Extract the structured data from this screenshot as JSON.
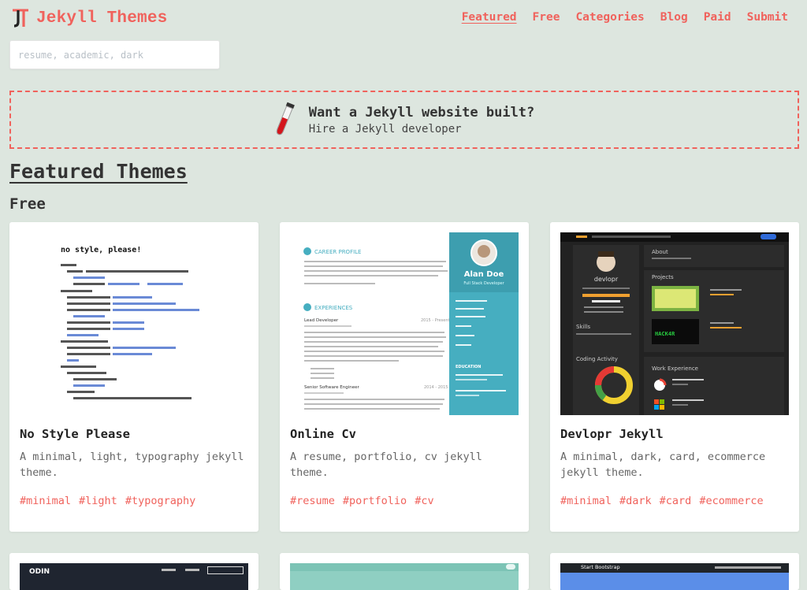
{
  "site": {
    "title": "Jekyll Themes",
    "logo_letters": "JT"
  },
  "nav": [
    {
      "label": "Featured",
      "active": true
    },
    {
      "label": "Free",
      "active": false
    },
    {
      "label": "Categories",
      "active": false
    },
    {
      "label": "Blog",
      "active": false
    },
    {
      "label": "Paid",
      "active": false
    },
    {
      "label": "Submit",
      "active": false
    }
  ],
  "search": {
    "placeholder": "resume, academic, dark"
  },
  "hire": {
    "title": "Want a Jekyll website built?",
    "subtitle": "Hire a Jekyll developer"
  },
  "section_title": "Featured Themes",
  "subsection_title": "Free",
  "cards": [
    {
      "name": "No Style Please",
      "description": "A minimal, light, typography jekyll theme.",
      "tags": [
        "#minimal",
        "#light",
        "#typography"
      ],
      "thumb_title": "no style, please!"
    },
    {
      "name": "Online Cv",
      "description": "A resume, portfolio, cv jekyll theme.",
      "tags": [
        "#resume",
        "#portfolio",
        "#cv"
      ],
      "thumb_name": "Alan Doe",
      "thumb_role": "Full Stack Developer",
      "thumb_career": "CAREER PROFILE",
      "thumb_experiences": "EXPERIENCES",
      "thumb_job1": "Lead Developer",
      "thumb_year1": "2015 - Present",
      "thumb_job2": "Senior Software Engineer",
      "thumb_year2": "2014 - 2015",
      "thumb_education": "EDUCATION"
    },
    {
      "name": "Devlopr Jekyll",
      "description": "A minimal, dark, card, ecommerce jekyll theme.",
      "tags": [
        "#minimal",
        "#dark",
        "#card",
        "#ecommerce"
      ],
      "thumb_about": "About",
      "thumb_projects": "Projects",
      "thumb_skills": "Skills",
      "thumb_coding": "Coding Activity",
      "thumb_work": "Work Experience",
      "thumb_devname": "devlopr",
      "thumb_hack": "HACK4R"
    }
  ],
  "next_row": [
    {
      "label": "ODIN"
    },
    {
      "label": ""
    },
    {
      "label": "Start Bootstrap"
    }
  ],
  "colors": {
    "accent": "#f0625c",
    "background": "#dde6df",
    "card": "#ffffff",
    "cv_sidebar": "#46aec0"
  }
}
